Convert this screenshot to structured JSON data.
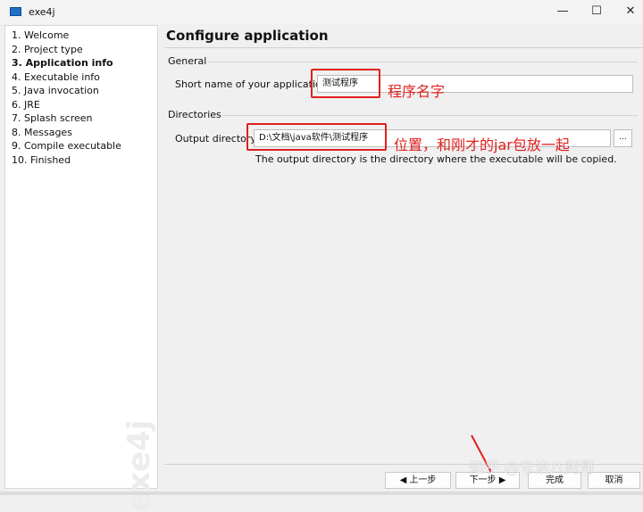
{
  "window": {
    "title": "exe4j",
    "controls": {
      "minimize": "—",
      "maximize": "☐",
      "close": "✕"
    }
  },
  "sidebar": {
    "steps": [
      "1. Welcome",
      "2. Project type",
      "3. Application info",
      "4. Executable info",
      "5. Java invocation",
      "6. JRE",
      "7. Splash screen",
      "8. Messages",
      "9. Compile executable",
      "10. Finished"
    ],
    "active_index": 2,
    "logo": "exe4j"
  },
  "main": {
    "heading": "Configure application",
    "general": {
      "title": "General",
      "short_name_label": "Short name of your application:",
      "short_name_value": "测试程序"
    },
    "directories": {
      "title": "Directories",
      "output_label": "Output directory:",
      "output_value": "D:\\文档\\java软件\\测试程序",
      "browse_label": "...",
      "hint": "The output directory is the directory where the executable will be copied."
    }
  },
  "annotations": {
    "name_note": "程序名字",
    "dir_note": "位置，和刚才的jar包放一起",
    "watermark": "知乎 @专治八阿哥"
  },
  "buttons": {
    "back": "◀ 上一步",
    "next": "下一步 ▶",
    "finish": "完成",
    "cancel": "取消"
  },
  "colors": {
    "annotation": "#e0201e"
  }
}
